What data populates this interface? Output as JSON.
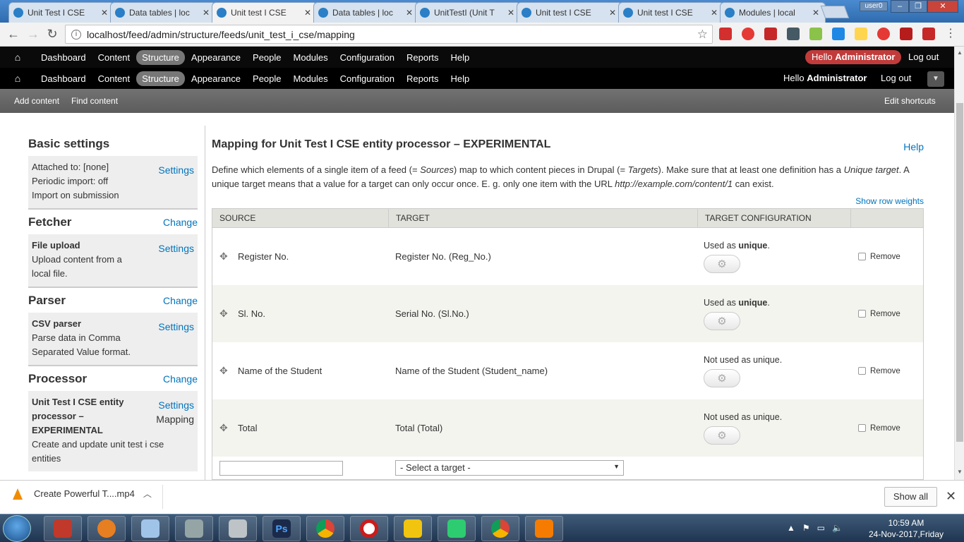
{
  "browser": {
    "tabs": [
      {
        "label": "Unit Test I CSE",
        "active": false
      },
      {
        "label": "Data tables | loc",
        "active": false
      },
      {
        "label": "Unit test I CSE",
        "active": true
      },
      {
        "label": "Data tables | loc",
        "active": false
      },
      {
        "label": "UnitTestI (Unit T",
        "active": false
      },
      {
        "label": "Unit test I CSE",
        "active": false
      },
      {
        "label": "Unit test I CSE",
        "active": false
      },
      {
        "label": "Modules | local",
        "active": false
      }
    ],
    "user_badge": "user0",
    "url": "localhost/feed/admin/structure/feeds/unit_test_i_cse/mapping"
  },
  "admin_menu": {
    "home": "⌂",
    "items": [
      "Dashboard",
      "Content",
      "Structure",
      "Appearance",
      "People",
      "Modules",
      "Configuration",
      "Reports",
      "Help"
    ],
    "active": "Structure",
    "hello": "Hello ",
    "username": "Administrator",
    "logout": "Log out"
  },
  "toolbar": {
    "items": [
      "Dashboard",
      "Content",
      "Structure",
      "Appearance",
      "People",
      "Modules",
      "Configuration",
      "Reports",
      "Help"
    ],
    "hello": "Hello ",
    "username": "Administrator",
    "logout": "Log out",
    "shortcuts": [
      "Add content",
      "Find content"
    ],
    "edit_shortcuts": "Edit shortcuts"
  },
  "sidebar": {
    "basic": {
      "title": "Basic settings",
      "lines": [
        "Attached to: [none]",
        "Periodic import: off",
        "Import on submission"
      ],
      "link": "Settings"
    },
    "fetcher": {
      "title": "Fetcher",
      "change": "Change",
      "name": "File upload",
      "lines": [
        "Upload content from a",
        "local file."
      ],
      "link": "Settings"
    },
    "parser": {
      "title": "Parser",
      "change": "Change",
      "name": "CSV parser",
      "lines": [
        "Parse data in Comma",
        "Separated Value format."
      ],
      "link": "Settings"
    },
    "processor": {
      "title": "Processor",
      "change": "Change",
      "name_lines": [
        "Unit Test I CSE entity",
        "processor –",
        "EXPERIMENTAL"
      ],
      "lines": [
        "Create and update unit test i cse",
        "entities"
      ],
      "link": "Settings",
      "mapping": "Mapping"
    }
  },
  "main": {
    "title": "Mapping for Unit Test I CSE entity processor – EXPERIMENTAL",
    "help": "Help",
    "desc": {
      "p1": "Define which elements of a single item of a feed (= ",
      "sources": "Sources",
      "p2": ") map to which content pieces in Drupal (= ",
      "targets": "Targets",
      "p3": "). Make sure that at least one definition has a ",
      "unique_target": "Unique target",
      "p4": ". A unique target means that a value for a target can only occur once. E. g. only one item with the URL ",
      "url": "http://example.com/content/1",
      "p5": " can exist."
    },
    "show_weights": "Show row weights",
    "columns": [
      "SOURCE",
      "TARGET",
      "TARGET CONFIGURATION",
      ""
    ],
    "rows": [
      {
        "source": "Register No.",
        "target": "Register No. (Reg_No.)",
        "config_pre": "Used as ",
        "config_bold": "unique",
        "config_post": ".",
        "remove": "Remove"
      },
      {
        "source": "Sl. No.",
        "target": "Serial No. (Sl.No.)",
        "config_pre": "Used as ",
        "config_bold": "unique",
        "config_post": ".",
        "remove": "Remove"
      },
      {
        "source": "Name of the Student",
        "target": "Name of the Student (Student_name)",
        "config_pre": "Not used as unique.",
        "config_bold": "",
        "config_post": "",
        "remove": "Remove"
      },
      {
        "source": "Total",
        "target": "Total (Total)",
        "config_pre": "Not used as unique.",
        "config_bold": "",
        "config_post": "",
        "remove": "Remove"
      }
    ],
    "select_target": "- Select a target -"
  },
  "downloads": {
    "file": "Create Powerful T....mp4",
    "show_all": "Show all"
  },
  "taskbar": {
    "time": "10:59 AM",
    "date": "24-Nov-2017,Friday"
  }
}
